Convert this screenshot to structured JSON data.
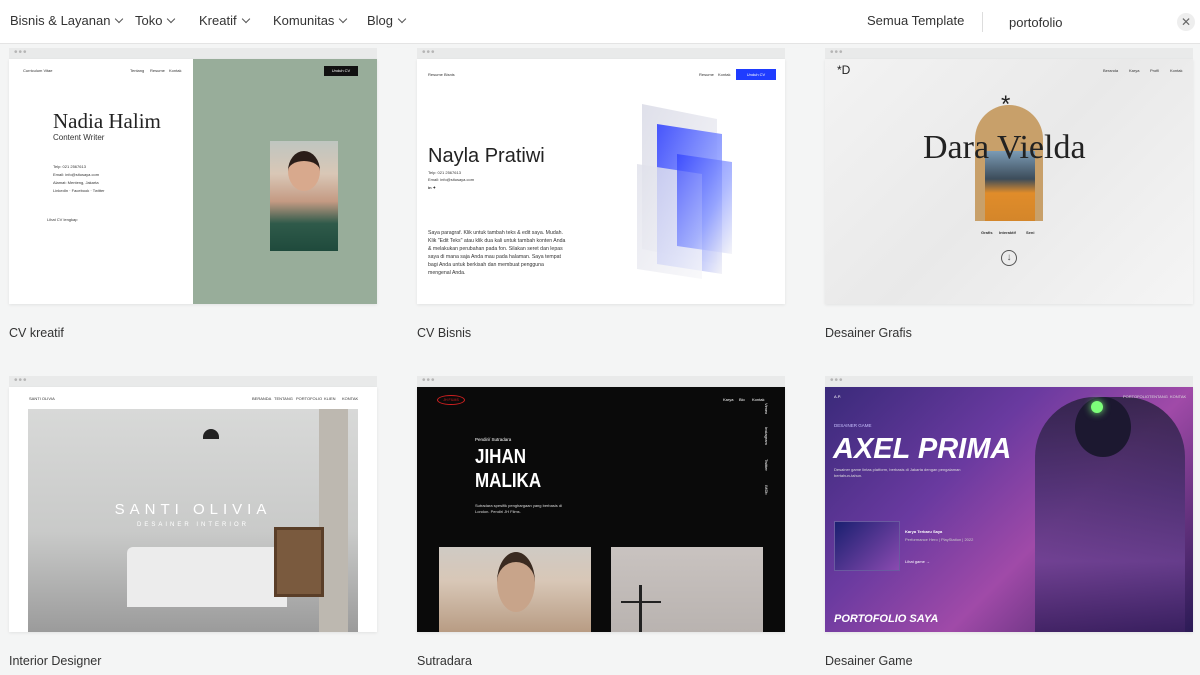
{
  "nav": {
    "items": [
      {
        "label": "Bisnis & Layanan"
      },
      {
        "label": "Toko"
      },
      {
        "label": "Kreatif"
      },
      {
        "label": "Komunitas"
      },
      {
        "label": "Blog"
      }
    ],
    "all_templates": "Semua Template",
    "search_value": "portofolio",
    "clear_icon": "close-icon"
  },
  "cards": [
    {
      "caption": "CV kreatif",
      "thumb": {
        "site": "Curriculum Vitae",
        "links": [
          "Tentang",
          "Resume",
          "Kontak"
        ],
        "button": "Unduh CV",
        "name": "Nadia Halim",
        "role": "Content Writer",
        "contact": [
          "Telp: 021 2567613",
          "Email: info@situsaya.com",
          "Alamat: Menteng, Jakarta",
          "LinkedIn · Facebook · Twitter"
        ],
        "more": "Lihat CV lengkap"
      }
    },
    {
      "caption": "CV Bisnis",
      "thumb": {
        "site": "Resume Bisnis",
        "links": [
          "Resume",
          "Kontak"
        ],
        "button": "Unduh CV",
        "name": "Nayla Pratiwi",
        "contact": [
          "Telp: 021 2567613",
          "Email: info@situsaya.com"
        ],
        "social": "in ✦",
        "paragraph": "Saya paragraf. Klik untuk tambah teks & edit saya. Mudah. Klik \"Edit Teks\" atau klik dua kali untuk tambah konten Anda & melakukan perubahan pada fon. Silakan seret dan lepas saya di mana saja Anda mau pada halaman. Saya tempat bagi Anda untuk berkisah dan membuat pengguna mengenal Anda."
      }
    },
    {
      "caption": "Desainer Grafis",
      "thumb": {
        "logo": "*D",
        "links": [
          "Beranda",
          "Karya",
          "Profil",
          "Kontak"
        ],
        "name": "Dara Vielda",
        "star": "*",
        "tags": [
          "Grafis",
          "Interaktif",
          "Seni"
        ],
        "arrow": "↓"
      }
    },
    {
      "caption": "Interior Designer",
      "thumb": {
        "site": "SANTI OLIVIA",
        "links": [
          "BERANDA",
          "TENTANG",
          "PORTOFOLIO",
          "KLIEN",
          "KONTAK"
        ],
        "name": "SANTI OLIVIA",
        "role": "DESAINER INTERIOR"
      }
    },
    {
      "caption": "Sutradara",
      "thumb": {
        "logo": "JH FILMS",
        "links": [
          "Karya",
          "Bio",
          "Kontak"
        ],
        "side_links": [
          "Vimeo",
          "Instagram",
          "Twitter",
          "IMDb"
        ],
        "kicker": "Pendiri/ Sutradara",
        "name_line1": "JIHAN",
        "name_line2": "MALIKA",
        "bio": "Sutradara spesifik penghargaan yang berbasis di London. Pendiri JH Films."
      }
    },
    {
      "caption": "Desainer Game",
      "thumb": {
        "logo": "A.P.",
        "links": [
          "PORTOFOLIO",
          "TENTANG",
          "KONTAK"
        ],
        "kicker": "DESAINER GAME",
        "name": "AXEL PRIMA",
        "bio": "Desainer game lintas platform, berbasis di Jakarta dengan pengalaman bertahun-tahun.",
        "work_title": "Karya Terbaru Saya",
        "work_sub": "Performance Hero | PlayStation | 2022",
        "work_link": "Lihat game  →",
        "footer": "PORTOFOLIO SAYA"
      }
    }
  ],
  "colors": {
    "page_bg": "#f4f5f5",
    "cv_green": "#98ad9a",
    "cv_blue_button": "#1f3cff",
    "arch_gold": "#c8a06a",
    "red_logo": "#d02020",
    "neon_green": "#7dff7a"
  }
}
